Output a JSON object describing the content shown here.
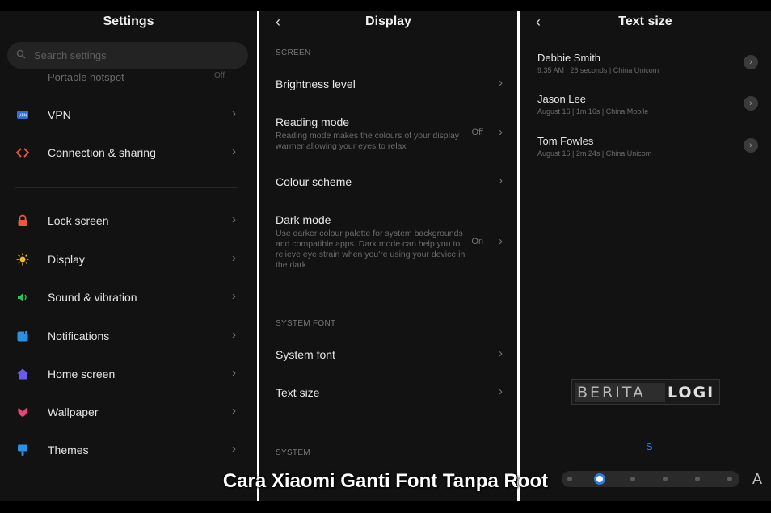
{
  "settings": {
    "title": "Settings",
    "search_placeholder": "Search settings",
    "hotspot_label": "Portable hotspot",
    "hotspot_value": "Off",
    "items": [
      {
        "label": "VPN",
        "icon": "vpn-icon",
        "color": "#2d6fd6"
      },
      {
        "label": "Connection & sharing",
        "icon": "connection-sharing-icon",
        "color": "#e2553d"
      },
      {
        "label": "Lock screen",
        "icon": "lock-icon",
        "color": "#e85a3c"
      },
      {
        "label": "Display",
        "icon": "sun-icon",
        "color": "#f2b632"
      },
      {
        "label": "Sound & vibration",
        "icon": "speaker-icon",
        "color": "#2fbf5b"
      },
      {
        "label": "Notifications",
        "icon": "notifications-icon",
        "color": "#2d8fe0"
      },
      {
        "label": "Home screen",
        "icon": "home-icon",
        "color": "#6a5ce8"
      },
      {
        "label": "Wallpaper",
        "icon": "wallpaper-icon",
        "color": "#e8457a"
      },
      {
        "label": "Themes",
        "icon": "themes-icon",
        "color": "#2d8fe0"
      }
    ]
  },
  "display": {
    "title": "Display",
    "section_screen": "SCREEN",
    "brightness": "Brightness level",
    "reading_mode": "Reading mode",
    "reading_mode_desc": "Reading mode makes the colours of your display warmer allowing your eyes to relax",
    "reading_mode_value": "Off",
    "colour_scheme": "Colour scheme",
    "dark_mode": "Dark mode",
    "dark_mode_desc": "Use darker colour palette for system backgrounds and compatible apps. Dark mode can help you to relieve eye strain when you're using your device in the dark",
    "dark_mode_value": "On",
    "section_font": "SYSTEM FONT",
    "system_font": "System font",
    "text_size": "Text size",
    "section_system": "SYSTEM"
  },
  "text_size": {
    "title": "Text size",
    "contacts": [
      {
        "name": "Debbie Smith",
        "meta": "9:35 AM | 26 seconds | China Unicom"
      },
      {
        "name": "Jason Lee",
        "meta": "August 16 | 1m 16s | China Mobile"
      },
      {
        "name": "Tom Fowles",
        "meta": "August 16 | 2m 24s | China Unicom"
      }
    ],
    "small_label": "S",
    "large_label": "A",
    "slider_level_index": 1,
    "slider_positions": 6,
    "accent": "#2f7fd8"
  },
  "watermark": {
    "part1": "BERITA",
    "part2": "LOGI"
  },
  "caption": "Cara Xiaomi Ganti Font Tanpa Root"
}
